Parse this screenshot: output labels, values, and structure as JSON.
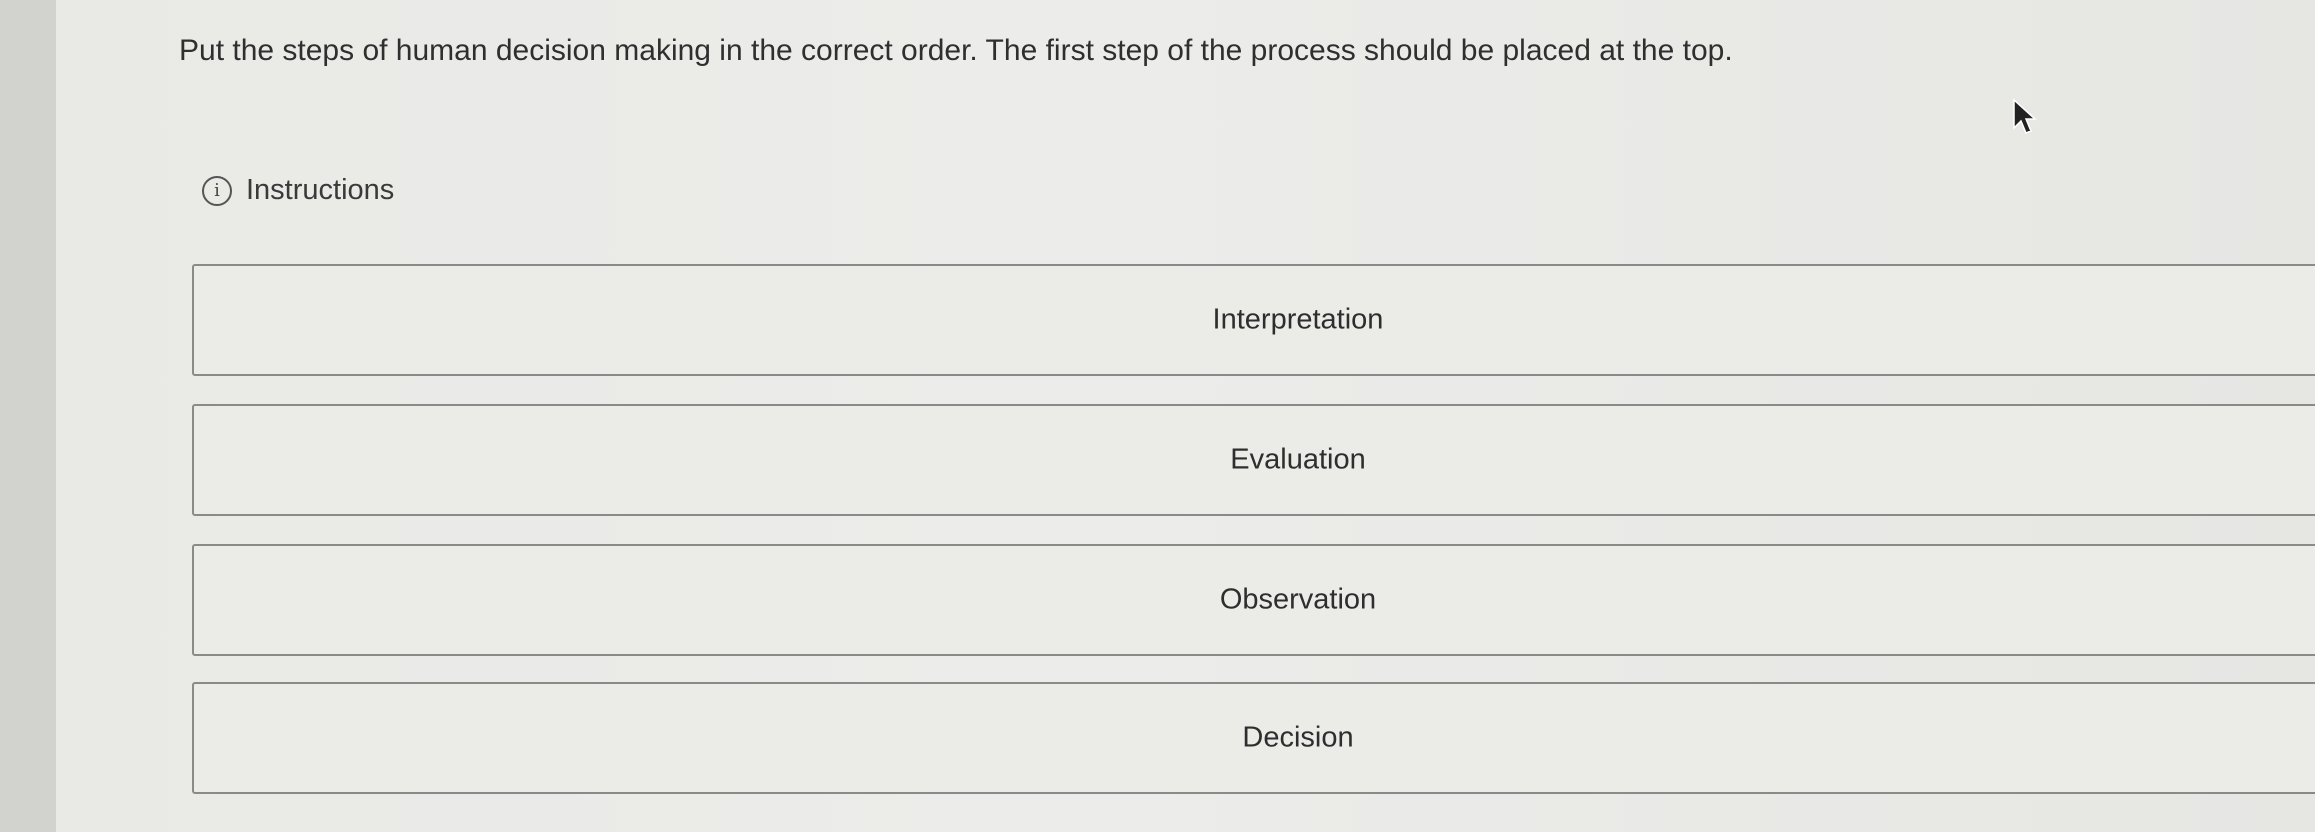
{
  "question": {
    "text": "Put the steps of human decision making in the correct order. The first step of the process should be placed at the top."
  },
  "instructions": {
    "icon": "info-icon",
    "label": "Instructions"
  },
  "sortable_items": [
    {
      "label": "Interpretation"
    },
    {
      "label": "Evaluation"
    },
    {
      "label": "Observation"
    },
    {
      "label": "Decision"
    }
  ],
  "colors": {
    "page_background": "#ebebe8",
    "text": "#2f2f2f",
    "item_border": "#8a8a88"
  }
}
